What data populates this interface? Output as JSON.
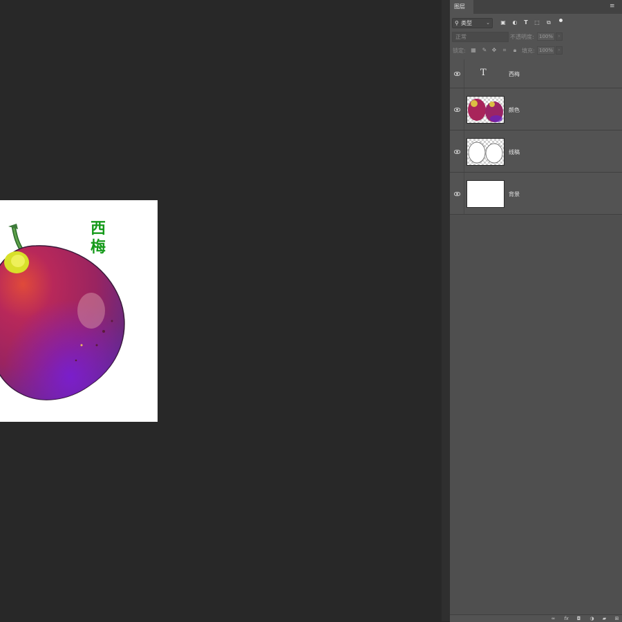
{
  "canvas": {
    "document_text": "西梅"
  },
  "layers_panel": {
    "tab_label": "图层",
    "filter": {
      "kind_label": "类型",
      "icons": [
        "image-filter-icon",
        "adjustment-filter-icon",
        "type-filter-icon",
        "shape-filter-icon",
        "smart-object-filter-icon"
      ]
    },
    "blend": {
      "mode": "正常",
      "opacity_label": "不透明度:",
      "opacity_value": "100%"
    },
    "lock": {
      "label": "锁定:",
      "fill_label": "填充:",
      "fill_value": "100%"
    },
    "layers": [
      {
        "name": "西梅",
        "kind": "text",
        "visible": true
      },
      {
        "name": "颜色",
        "kind": "raster",
        "visible": true
      },
      {
        "name": "线稿",
        "kind": "raster",
        "visible": true
      },
      {
        "name": "背景",
        "kind": "background",
        "visible": true
      }
    ],
    "bottom_icons": [
      "link-layers-icon",
      "fx-icon",
      "add-mask-icon",
      "new-adjustment-icon",
      "new-group-icon",
      "new-layer-icon"
    ],
    "fx_label": "fx"
  },
  "colors": {
    "canvas_bg": "#282828",
    "panel_bg": "#535353",
    "plum": "#a8245a",
    "title_green": "#159a1a"
  }
}
